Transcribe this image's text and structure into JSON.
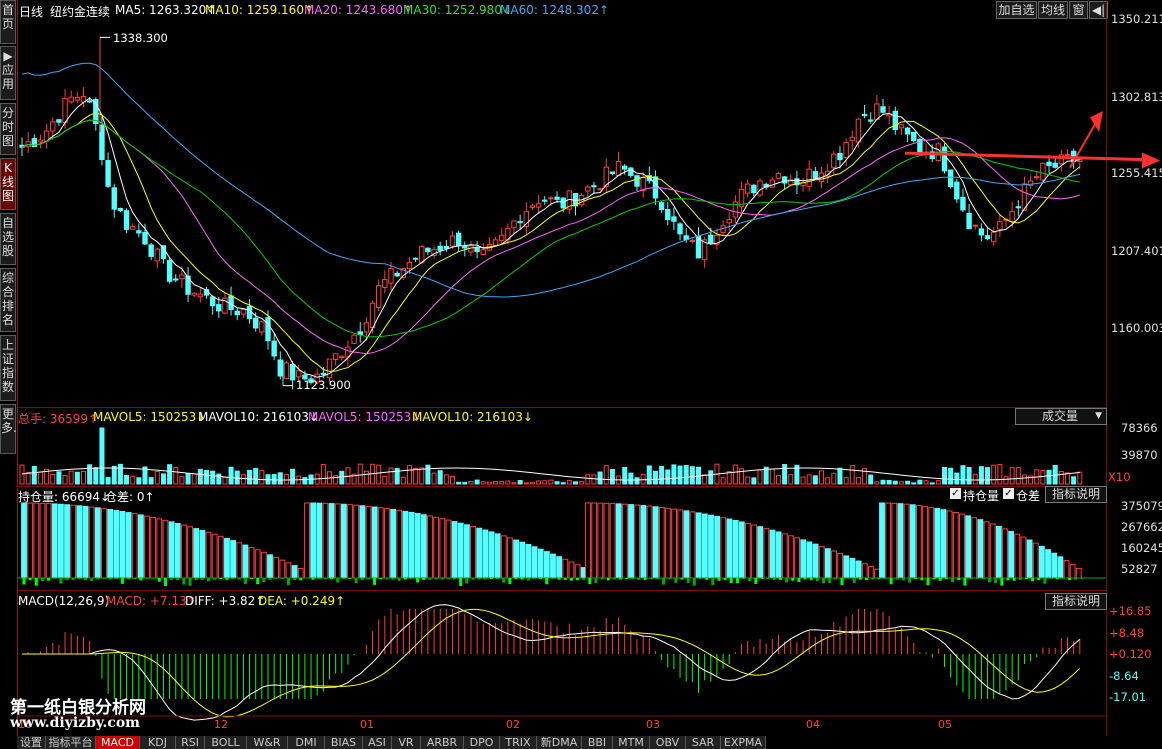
{
  "colors": {
    "up": "#ff3c3c",
    "down": "#54ffff",
    "ma5": "#ffffff",
    "ma10": "#ffff00",
    "ma20": "#ff66ff",
    "ma30": "#00cc00",
    "ma60": "#3fa9f5",
    "grid": "#7a1010"
  },
  "sidebar": [
    {
      "label": "首页",
      "active": false
    },
    {
      "label": "▶应用",
      "active": false
    },
    {
      "label": "分时图",
      "active": false
    },
    {
      "label": "K线图",
      "active": true
    },
    {
      "label": "自选股",
      "active": false
    },
    {
      "label": "综合排名",
      "active": false
    },
    {
      "label": "上证指数",
      "active": false
    },
    {
      "label": "更多.",
      "active": false
    }
  ],
  "header": {
    "period": "日线",
    "instrument": "纽约金连续",
    "ma5_label": "MA5: 1263.320↑",
    "ma10_label": "MA10: 1259.160↑",
    "ma20_label": "MA20: 1243.680↑",
    "ma30_label": "MA30: 1252.980↓",
    "ma60_label": "MA60: 1248.302↑",
    "add_watch": "加自选",
    "ma_line": "均线",
    "window": "窗",
    "pin": "◀|"
  },
  "price_axis": [
    "1350.211",
    "1302.813",
    "1255.415",
    "1207.401",
    "1160.003"
  ],
  "annotations": {
    "high": "1338.300",
    "low": "1123.900"
  },
  "volume_panel": {
    "total_label": "总手: 36599↑",
    "mavol5_label": "MAVOL5: 150253↓",
    "mavol10_label": "MAVOL10: 216103↓",
    "mavol5b_label": "MAVOL5: 150253↓",
    "mavol10b_label": "MAVOL10: 216103↓",
    "indicator_select": "成交量",
    "axis": [
      "78366",
      "39870"
    ],
    "unit": "X10"
  },
  "oi_panel": {
    "label": "持仓量: 66694↓",
    "diff_label": "仓差: 0↑",
    "check1": "持仓量",
    "check2": "仓差",
    "explain": "指标说明",
    "axis": [
      "375079",
      "267662",
      "160245",
      "52827"
    ]
  },
  "macd_panel": {
    "label": "MACD(12,26,9)",
    "macd": "MACD: +7.13↑",
    "diff": "DIFF: +3.82↑",
    "dea": "DEA: +0.249↑",
    "explain": "指标说明",
    "axis": [
      "+16.85",
      "+8.48",
      "+0.120",
      "-8.64",
      "-17.01"
    ]
  },
  "months": [
    {
      "label": "12"
    },
    {
      "label": "01"
    },
    {
      "label": "02"
    },
    {
      "label": "03"
    },
    {
      "label": "04"
    },
    {
      "label": "05"
    }
  ],
  "month_left_fragment": "10",
  "watermark": {
    "line1": "第一纸白银分析网",
    "line2": "www.diyizby.com"
  },
  "tabs": [
    "设置",
    "指标平台",
    "MACD",
    "KDJ",
    "RSI",
    "BOLL",
    "W&R",
    "DMI",
    "BIAS",
    "ASI",
    "VR",
    "ARBR",
    "DPO",
    "TRIX",
    "新DMA",
    "BBI",
    "MTM",
    "OBV",
    "SAR",
    "EXPMA"
  ],
  "active_tab": "MACD"
}
